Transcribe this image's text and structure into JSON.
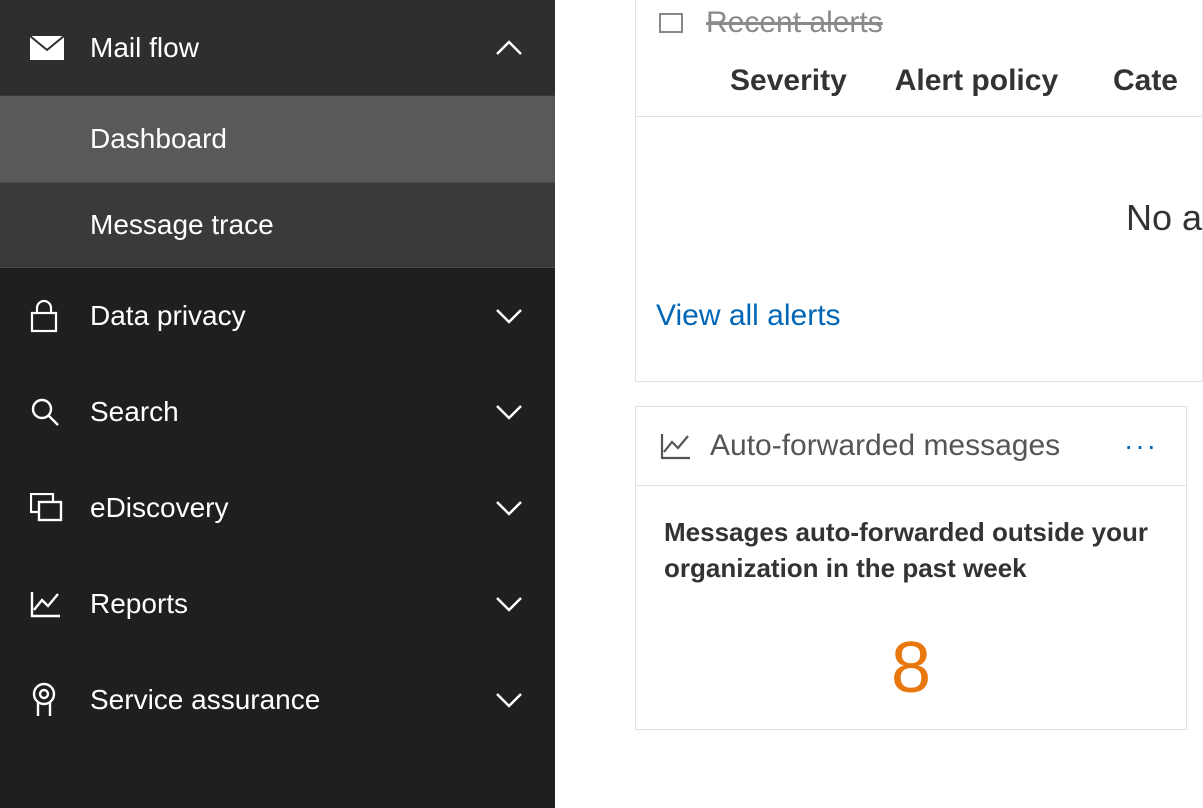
{
  "sidebar": {
    "mailflow": {
      "label": "Mail flow"
    },
    "mailflow_sub": {
      "dashboard": "Dashboard",
      "message_trace": "Message trace"
    },
    "data_privacy": {
      "label": "Data privacy"
    },
    "search": {
      "label": "Search"
    },
    "ediscovery": {
      "label": "eDiscovery"
    },
    "reports": {
      "label": "Reports"
    },
    "service_assurance": {
      "label": "Service assurance"
    }
  },
  "alerts": {
    "recent_title": "Recent alerts",
    "columns": {
      "severity": "Severity",
      "policy": "Alert policy",
      "category": "Cate"
    },
    "empty_text": "No a",
    "view_all": "View all alerts"
  },
  "card_autoforward": {
    "title": "Auto-forwarded messages",
    "desc": "Messages auto-forwarded outside your organization in the past week",
    "value": "8",
    "more": "···"
  }
}
